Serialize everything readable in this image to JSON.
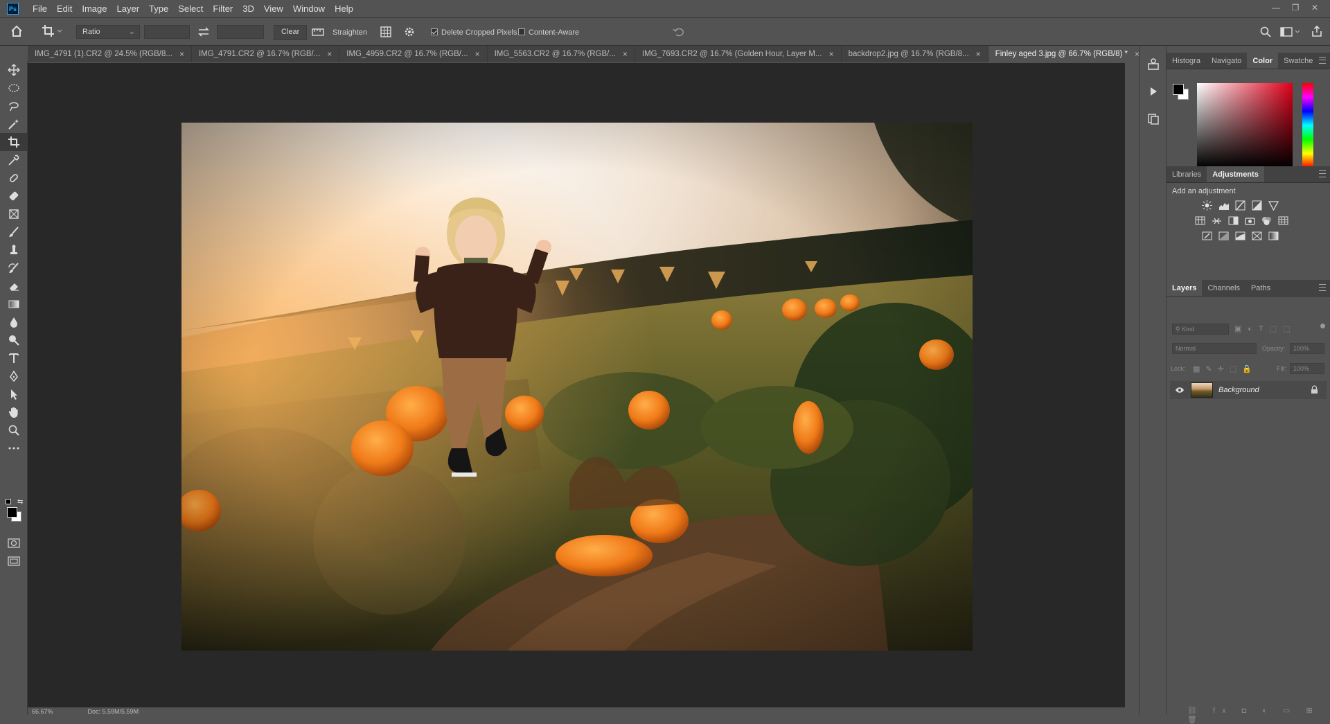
{
  "app": {
    "logo_text": "Ps"
  },
  "menu": [
    "File",
    "Edit",
    "Image",
    "Layer",
    "Type",
    "Select",
    "Filter",
    "3D",
    "View",
    "Window",
    "Help"
  ],
  "window_controls": [
    "—",
    "❐",
    "✕"
  ],
  "options_bar": {
    "ratio_select": "Ratio",
    "clear_label": "Clear",
    "straighten_label": "Straighten",
    "delete_cropped_label": "Delete Cropped Pixels",
    "delete_cropped_checked": true,
    "content_aware_label": "Content-Aware",
    "content_aware_checked": false
  },
  "tabs": [
    {
      "label": "IMG_4791 (1).CR2 @ 24.5% (RGB/8...",
      "active": false
    },
    {
      "label": "IMG_4791.CR2 @ 16.7% (RGB/...",
      "active": false
    },
    {
      "label": "IMG_4959.CR2 @ 16.7% (RGB/...",
      "active": false
    },
    {
      "label": "IMG_5563.CR2 @ 16.7% (RGB/...",
      "active": false
    },
    {
      "label": "IMG_7693.CR2 @ 16.7% (Golden Hour, Layer M...",
      "active": false
    },
    {
      "label": "backdrop2.jpg @ 16.7% (RGB/8...",
      "active": false
    },
    {
      "label": "Finley aged 3.jpg @ 66.7% (RGB/8) *",
      "active": true
    }
  ],
  "tools": [
    "move-tool",
    "marquee-tool",
    "lasso-tool",
    "magic-wand-tool",
    "crop-tool",
    "eyedropper-tool",
    "healing-brush-tool",
    "patch-tool",
    "frame-tool",
    "content-aware-move-tool",
    "brush-tool",
    "clone-stamp-tool",
    "history-brush-tool",
    "eraser-tool",
    "gradient-tool",
    "blur-tool",
    "sharpen-tool",
    "dodge-tool",
    "type-tool",
    "pen-tool",
    "path-selection-tool",
    "hand-tool",
    "zoom-tool",
    "more-tools"
  ],
  "status_bar": {
    "zoom": "66.67%",
    "doc": "Doc: 5.59M/5.59M"
  },
  "color_panel": {
    "tabs": [
      "Histogra",
      "Navigato",
      "Color",
      "Swatche"
    ],
    "active": "Color",
    "foreground": "#000000",
    "background": "#ffffff"
  },
  "adjustments_panel": {
    "tabs": [
      "Libraries",
      "Adjustments"
    ],
    "active": "Adjustments",
    "hint": "Add an adjustment"
  },
  "layers_panel": {
    "tabs": [
      "Layers",
      "Channels",
      "Paths"
    ],
    "active": "Layers",
    "kind_placeholder": "Kind",
    "blend_mode": "Normal",
    "opacity_label": "Opacity:",
    "opacity_value": "100%",
    "lock_label": "Lock:",
    "fill_label": "Fill:",
    "fill_value": "100%",
    "layers": [
      {
        "name": "Background",
        "visible": true,
        "locked": true
      }
    ]
  },
  "colors": {
    "accent": "#31a8ff",
    "spectrum_hue": "#e0001a"
  }
}
